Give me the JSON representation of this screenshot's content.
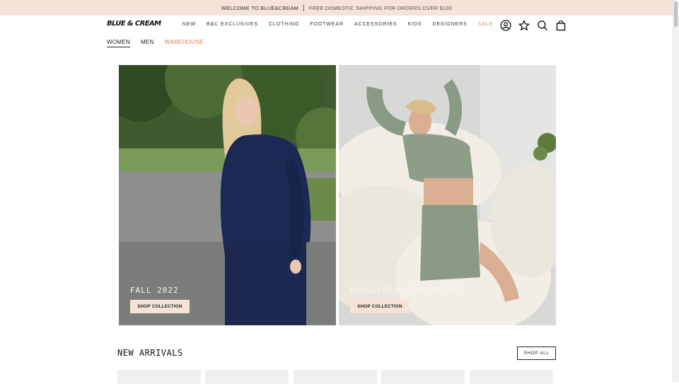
{
  "announcement": {
    "welcome": "WELCOME TO BLUE&CREAM",
    "separator": "|",
    "shipping": "FREE DOMESTIC SHIPPING FOR ORDERS OVER $100"
  },
  "brand": {
    "logo_text": "BLUE & CREAM"
  },
  "main_nav": [
    "NEW",
    "B&C EXCLUSIVES",
    "CLOTHING",
    "FOOTWEAR",
    "ACCESSORIES",
    "KIDS",
    "DESIGNERS",
    "SALE"
  ],
  "header_icons": [
    "account-icon",
    "wishlist-star-icon",
    "search-icon",
    "cart-bag-icon"
  ],
  "sub_nav": {
    "items": [
      "WOMEN",
      "MEN",
      "WAREHOUSE"
    ],
    "active": "WOMEN"
  },
  "heroes": [
    {
      "title": "FALL 2022",
      "button": "SHOP COLLECTION"
    },
    {
      "title": "BLUE&CREAM EXCLUSIVES",
      "button": "SHOP COLLECTION"
    }
  ],
  "new_arrivals": {
    "title": "NEW ARRIVALS",
    "button": "SHOP ALL"
  },
  "colors": {
    "announcement_bg": "#f5e3d8",
    "accent": "#e07a4f",
    "button_bg": "#f5e3d8"
  }
}
